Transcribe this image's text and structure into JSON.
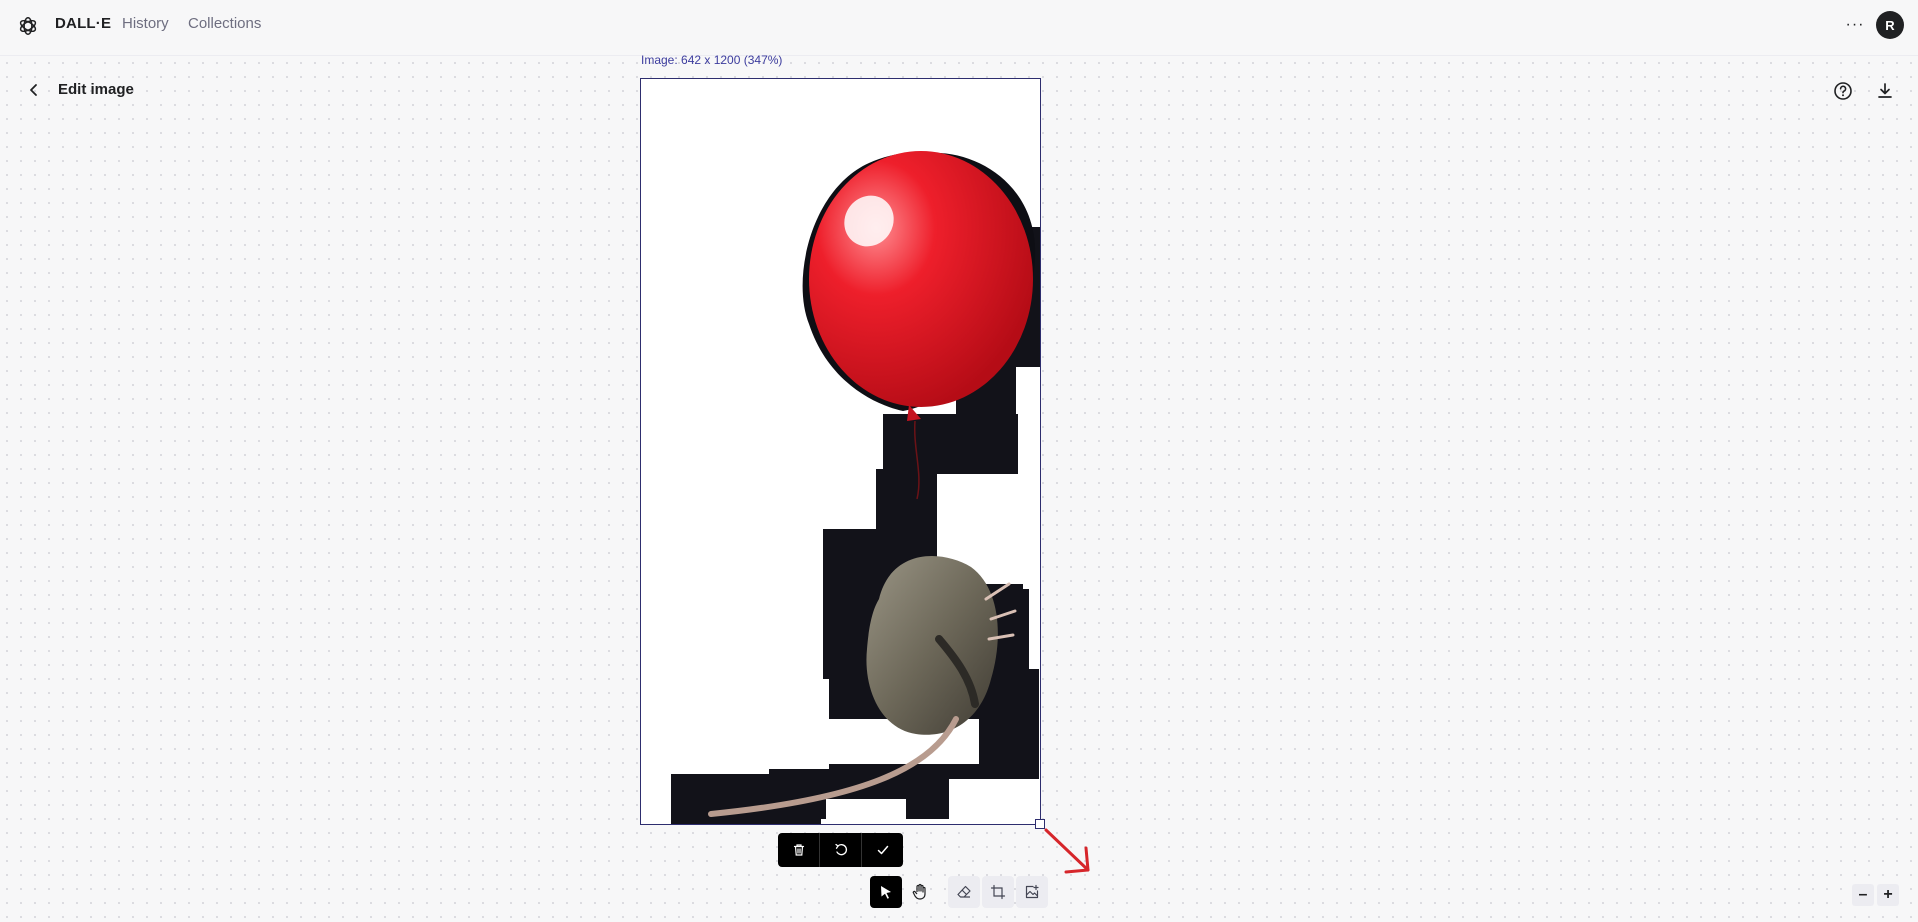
{
  "nav": {
    "brand": "DALL·E",
    "links": [
      "History",
      "Collections"
    ],
    "more": "···",
    "avatar_initial": "R"
  },
  "header": {
    "title": "Edit image"
  },
  "canvas": {
    "image_info": "Image: 642 x 1200 (347%)"
  },
  "selection_actions": [
    "delete",
    "undo",
    "confirm"
  ],
  "tools": [
    "select",
    "pan",
    "eraser",
    "add-generation-frame",
    "upload-image"
  ],
  "zoom": {
    "out": "–",
    "in": "+"
  },
  "colors": {
    "accent_frame": "#2d2d6e",
    "annotation_arrow": "#d6262b",
    "toolbar_active": "#000000"
  }
}
